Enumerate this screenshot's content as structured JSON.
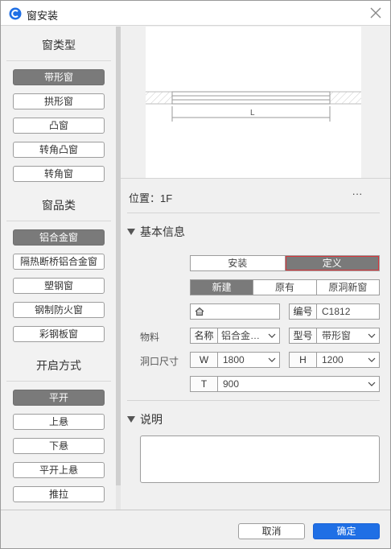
{
  "window": {
    "title": "窗安装"
  },
  "left": {
    "sections": [
      {
        "title": "窗类型",
        "items": [
          "带形窗",
          "拱形窗",
          "凸窗",
          "转角凸窗",
          "转角窗"
        ],
        "active": 0
      },
      {
        "title": "窗品类",
        "items": [
          "铝合金窗",
          "隔热断桥铝合金窗",
          "塑钢窗",
          "钢制防火窗",
          "彩钢板窗"
        ],
        "active": 0
      },
      {
        "title": "开启方式",
        "items": [
          "平开",
          "上悬",
          "下悬",
          "平开上悬",
          "推拉"
        ],
        "active": 0
      }
    ]
  },
  "preview": {
    "dimension_label": "L"
  },
  "position": {
    "label": "位置：1F",
    "more": "···"
  },
  "basic": {
    "header": "基本信息",
    "tabs": [
      "安装",
      "定义"
    ],
    "tab_active": 1,
    "source_tabs": [
      "新建",
      "原有",
      "原洞新窗"
    ],
    "source_active": 0,
    "name_value": "",
    "number": {
      "label": "编号",
      "value": "C1812"
    },
    "material": {
      "row_label": "物料",
      "name_label": "名称",
      "name_value": "铝合金…",
      "type_label": "型号",
      "type_value": "带形窗"
    },
    "opening": {
      "row_label": "洞口尺寸",
      "w_label": "W",
      "w_value": "1800",
      "h_label": "H",
      "h_value": "1200",
      "t_label": "T",
      "t_value": "900"
    }
  },
  "notes": {
    "header": "说明",
    "value": ""
  },
  "footer": {
    "cancel": "取消",
    "ok": "确定"
  },
  "colors": {
    "accent": "#1f6fe5",
    "active_gray": "#7a7a7a",
    "highlight_red": "#d9343a"
  }
}
